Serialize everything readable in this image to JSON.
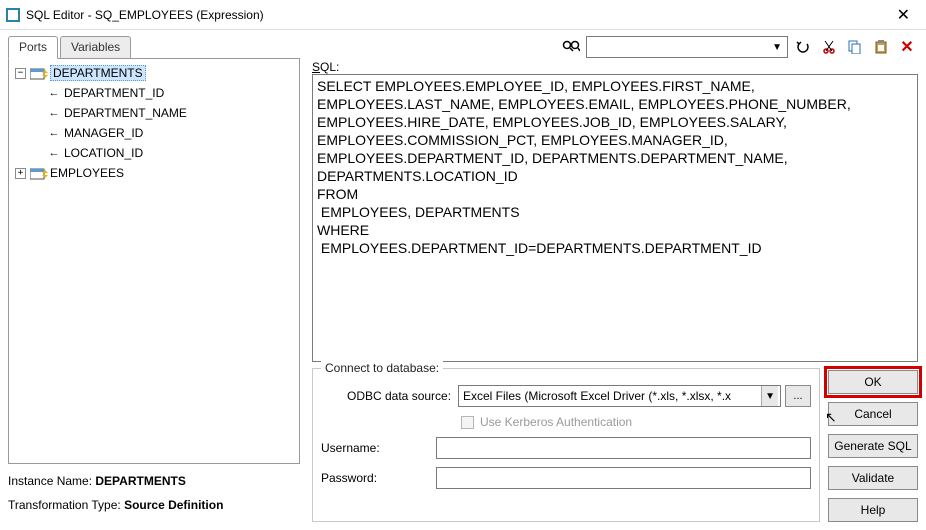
{
  "window": {
    "title": "SQL Editor - SQ_EMPLOYEES (Expression)"
  },
  "tabs": {
    "ports": "Ports",
    "variables": "Variables"
  },
  "tree": {
    "root1": "DEPARTMENTS",
    "root1_children": [
      "DEPARTMENT_ID",
      "DEPARTMENT_NAME",
      "MANAGER_ID",
      "LOCATION_ID"
    ],
    "root2": "EMPLOYEES"
  },
  "instance": {
    "name_label": "Instance Name:",
    "name_value": "DEPARTMENTS",
    "type_label": "Transformation Type:",
    "type_value": "Source Definition"
  },
  "sql": {
    "label_prefix": "S",
    "label_rest": "QL:",
    "text": "SELECT EMPLOYEES.EMPLOYEE_ID, EMPLOYEES.FIRST_NAME, EMPLOYEES.LAST_NAME, EMPLOYEES.EMAIL, EMPLOYEES.PHONE_NUMBER, EMPLOYEES.HIRE_DATE, EMPLOYEES.JOB_ID, EMPLOYEES.SALARY, EMPLOYEES.COMMISSION_PCT, EMPLOYEES.MANAGER_ID, EMPLOYEES.DEPARTMENT_ID, DEPARTMENTS.DEPARTMENT_NAME, DEPARTMENTS.LOCATION_ID\nFROM\n EMPLOYEES, DEPARTMENTS\nWHERE\n EMPLOYEES.DEPARTMENT_ID=DEPARTMENTS.DEPARTMENT_ID"
  },
  "connect": {
    "legend": "Connect to database:",
    "odbc_label": "ODBC data source:",
    "odbc_value": "Excel Files (Microsoft Excel Driver (*.xls, *.xlsx, *.x",
    "browse": "...",
    "kerberos": "Use Kerberos Authentication",
    "username_label": "Username:",
    "username_value": "",
    "password_label": "Password:",
    "password_value": ""
  },
  "buttons": {
    "ok": "OK",
    "cancel": "Cancel",
    "generate": "Generate SQL",
    "validate": "Validate",
    "help": "Help"
  }
}
